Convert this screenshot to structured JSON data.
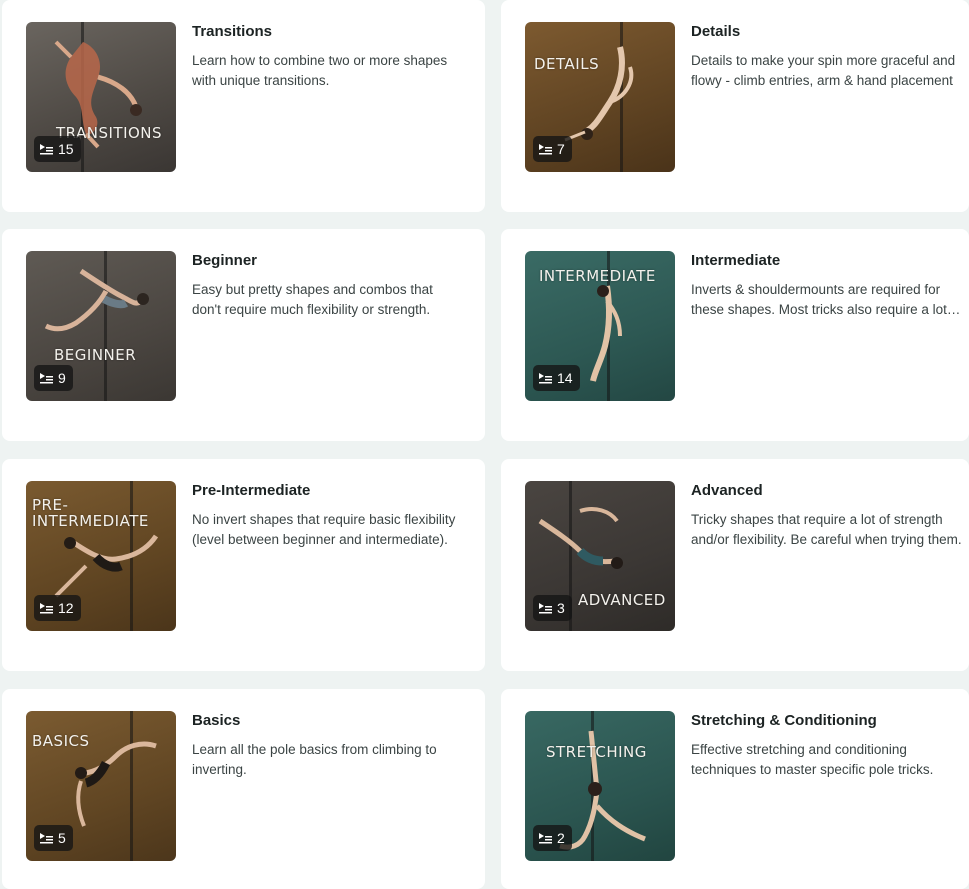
{
  "courses": [
    {
      "title": "Transitions",
      "description": "Learn how to combine two or more shapes with unique transitions.",
      "thumbnail_text": "TRANSITIONS",
      "video_count": "15",
      "thumbnail_color": "#5b5651"
    },
    {
      "title": "Details",
      "description": "Details to make your spin more graceful and flowy - climb entries, arm & hand placement",
      "thumbnail_text": "DETAILS",
      "video_count": "7",
      "thumbnail_color": "#6b4a26"
    },
    {
      "title": "Beginner",
      "description": "Easy but pretty shapes and combos that don't require much flexibility or strength.",
      "thumbnail_text": "BEGINNER",
      "video_count": "9",
      "thumbnail_color": "#4f4a44"
    },
    {
      "title": "Intermediate",
      "description": "Inverts & shouldermounts are required for these shapes. Most tricks also require a lot of practice.",
      "thumbnail_text": "INTERMEDIATE",
      "video_count": "14",
      "thumbnail_color": "#2f5a55"
    },
    {
      "title": "Pre-Intermediate",
      "description": "No invert shapes that require basic flexibility (level between beginner and intermediate).",
      "thumbnail_text": "PRE-\nINTERMEDIATE",
      "video_count": "12",
      "thumbnail_color": "#6c4f26"
    },
    {
      "title": "Advanced",
      "description": "Tricky shapes that require a lot of strength and/or flexibility. Be careful when trying them.",
      "thumbnail_text": "ADVANCED",
      "video_count": "3",
      "thumbnail_color": "#3e3a36"
    },
    {
      "title": "Basics",
      "description": "Learn all the pole basics from climbing to inverting.",
      "thumbnail_text": "BASICS",
      "video_count": "5",
      "thumbnail_color": "#6d4e27"
    },
    {
      "title": "Stretching & Conditioning",
      "description": "Effective stretching and conditioning techniques to master specific pole tricks.",
      "thumbnail_text": "STRETCHING",
      "video_count": "2",
      "thumbnail_color": "#2c5650"
    }
  ],
  "icons": {
    "badge_icon": "playlist-icon"
  }
}
